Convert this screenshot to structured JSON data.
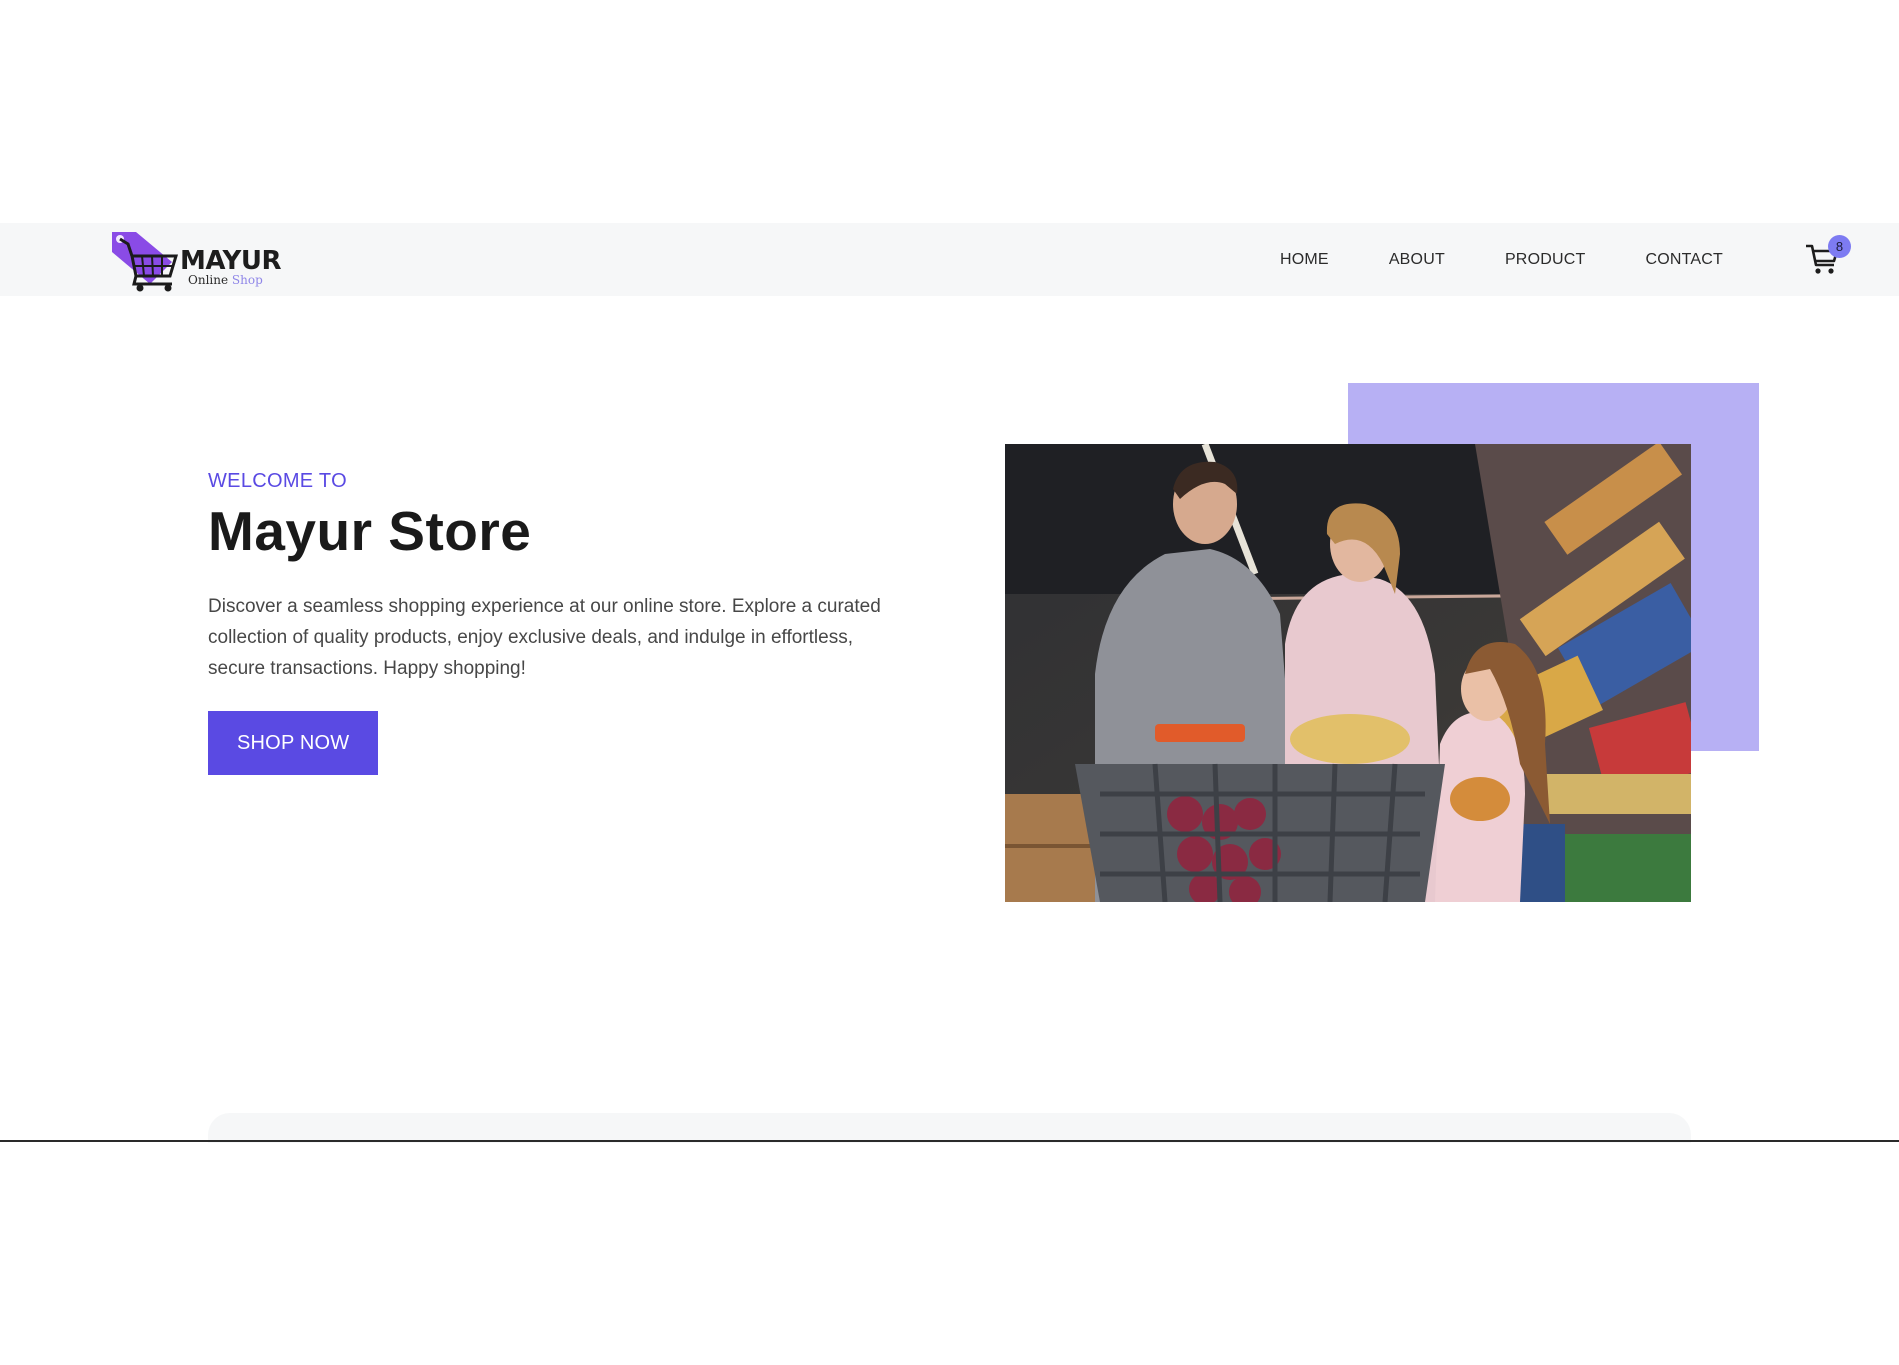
{
  "brand": {
    "name": "MAYUR",
    "tagline_part1": "Online",
    "tagline_part2": "Shop",
    "accent_color": "#5a4ae3"
  },
  "nav": {
    "items": [
      {
        "label": "HOME"
      },
      {
        "label": "ABOUT"
      },
      {
        "label": "PRODUCT"
      },
      {
        "label": "CONTACT"
      }
    ],
    "cart_icon": "shopping-cart-icon",
    "cart_count": "8"
  },
  "hero": {
    "eyebrow": "WELCOME TO",
    "title": "Mayur Store",
    "description": "Discover a seamless shopping experience at our online store. Explore a curated collection of quality products, enjoy exclusive deals, and indulge in effortless, secure transactions. Happy shopping!",
    "cta_label": "SHOP NOW",
    "accent_box_color": "#b7b0f4"
  }
}
